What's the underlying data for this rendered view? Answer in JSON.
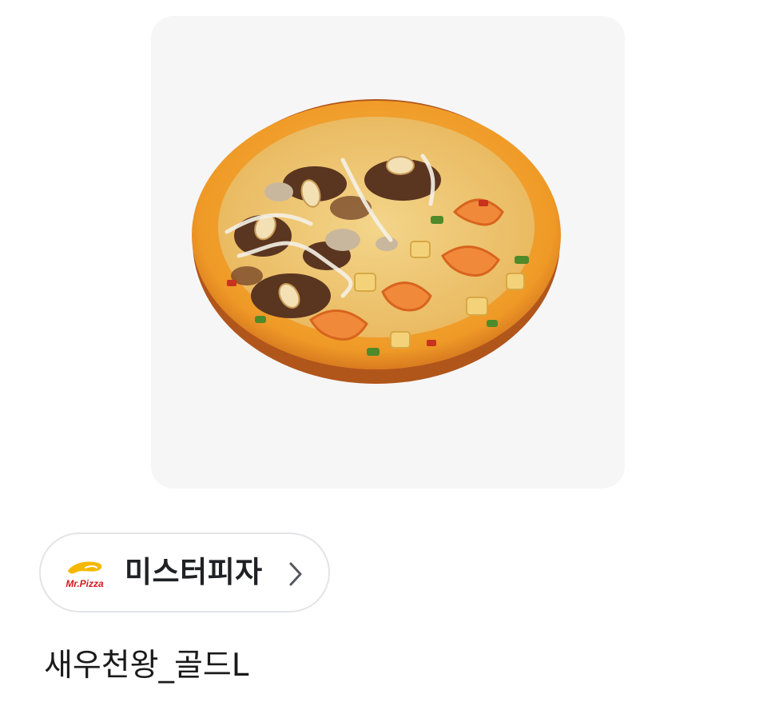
{
  "product_image": {
    "alt": "새우천왕_골드L",
    "icon": "pizza-image"
  },
  "brand": {
    "name": "미스터피자",
    "logo_text": "Mr.Pizza",
    "logo_icon": "mr-pizza-logo",
    "chevron_icon": "chevron-right-icon"
  },
  "product": {
    "title": "새우천왕_골드L"
  },
  "colors": {
    "card_background": "#f6f6f7",
    "chip_border": "#e3e4e7",
    "brand_text": "#1f2125",
    "logo_red": "#d71920",
    "logo_yellow": "#f5b800"
  }
}
